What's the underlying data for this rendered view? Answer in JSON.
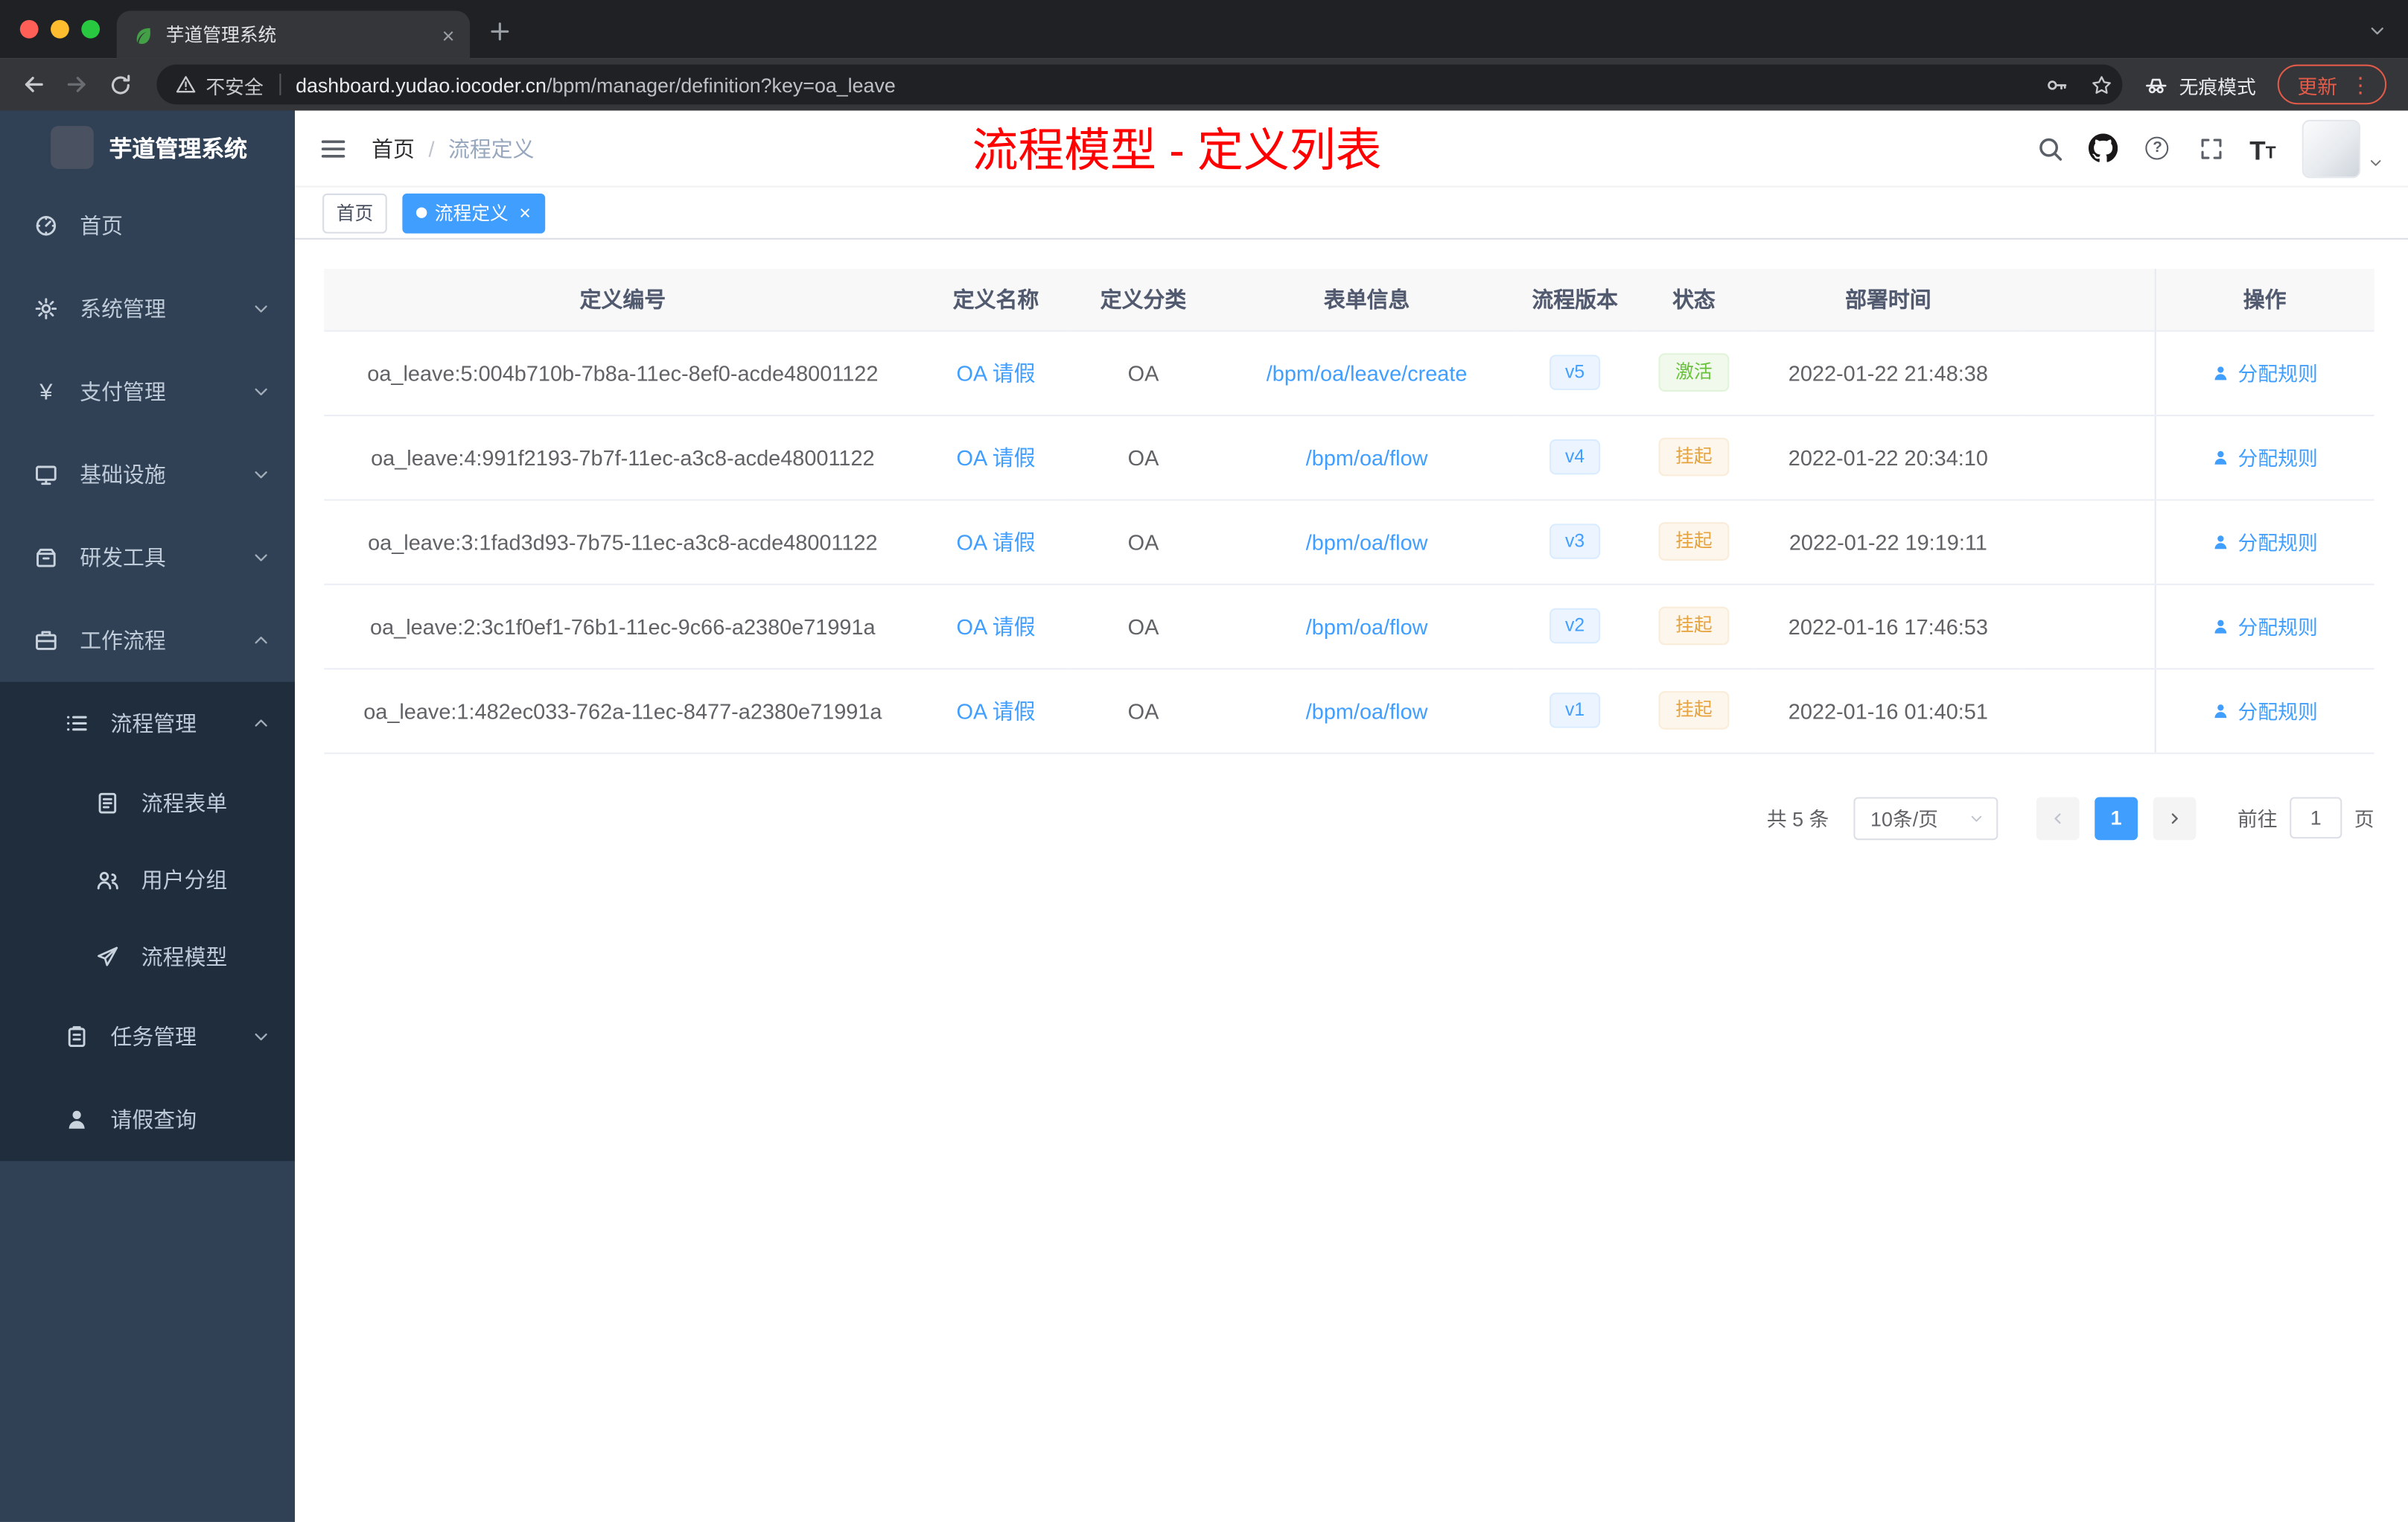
{
  "colors": {
    "accent": "#409eff",
    "success_text": "#67c23a",
    "warning_text": "#e6a23c",
    "annotation_red": "#ff0000",
    "sidebar_bg": "#304156",
    "sidebar_submenu_bg": "#1f2d3d"
  },
  "browser": {
    "tab_title": "芋道管理系统",
    "security_label": "不安全",
    "url_host": "dashboard.yudao.iocoder.cn",
    "url_path": "/bpm/manager/definition?key=oa_leave",
    "incognito_label": "无痕模式",
    "update_label": "更新"
  },
  "icons": {
    "yen": "¥",
    "help": "?",
    "font_size_large": "T",
    "font_size_small": "T",
    "more": "⋮",
    "close": "×"
  },
  "sidebar": {
    "logo_title": "芋道管理系统",
    "items": [
      {
        "label": "首页"
      },
      {
        "label": "系统管理"
      },
      {
        "label": "支付管理"
      },
      {
        "label": "基础设施"
      },
      {
        "label": "研发工具"
      },
      {
        "label": "工作流程"
      },
      {
        "label": "流程管理"
      },
      {
        "label": "流程表单"
      },
      {
        "label": "用户分组"
      },
      {
        "label": "流程模型"
      },
      {
        "label": "任务管理"
      },
      {
        "label": "请假查询"
      }
    ]
  },
  "header": {
    "breadcrumb_home": "首页",
    "breadcrumb_current": "流程定义",
    "annotation": "流程模型 - 定义列表"
  },
  "tags": {
    "home": "首页",
    "active": "流程定义"
  },
  "table": {
    "columns": [
      "定义编号",
      "定义名称",
      "定义分类",
      "表单信息",
      "流程版本",
      "状态",
      "部署时间",
      "操作"
    ],
    "rows": [
      {
        "id": "oa_leave:5:004b710b-7b8a-11ec-8ef0-acde48001122",
        "name": "OA 请假",
        "category": "OA",
        "form": "/bpm/oa/leave/create",
        "version": "v5",
        "status": "激活",
        "time": "2022-01-22 21:48:38",
        "action": "分配规则"
      },
      {
        "id": "oa_leave:4:991f2193-7b7f-11ec-a3c8-acde48001122",
        "name": "OA 请假",
        "category": "OA",
        "form": "/bpm/oa/flow",
        "version": "v4",
        "status": "挂起",
        "time": "2022-01-22 20:34:10",
        "action": "分配规则"
      },
      {
        "id": "oa_leave:3:1fad3d93-7b75-11ec-a3c8-acde48001122",
        "name": "OA 请假",
        "category": "OA",
        "form": "/bpm/oa/flow",
        "version": "v3",
        "status": "挂起",
        "time": "2022-01-22 19:19:11",
        "action": "分配规则"
      },
      {
        "id": "oa_leave:2:3c1f0ef1-76b1-11ec-9c66-a2380e71991a",
        "name": "OA 请假",
        "category": "OA",
        "form": "/bpm/oa/flow",
        "version": "v2",
        "status": "挂起",
        "time": "2022-01-16 17:46:53",
        "action": "分配规则"
      },
      {
        "id": "oa_leave:1:482ec033-762a-11ec-8477-a2380e71991a",
        "name": "OA 请假",
        "category": "OA",
        "form": "/bpm/oa/flow",
        "version": "v1",
        "status": "挂起",
        "time": "2022-01-16 01:40:51",
        "action": "分配规则"
      }
    ]
  },
  "pagination": {
    "total": "共 5 条",
    "page_size": "10条/页",
    "current_page": "1",
    "goto_label": "前往",
    "goto_value": "1",
    "goto_unit": "页"
  }
}
